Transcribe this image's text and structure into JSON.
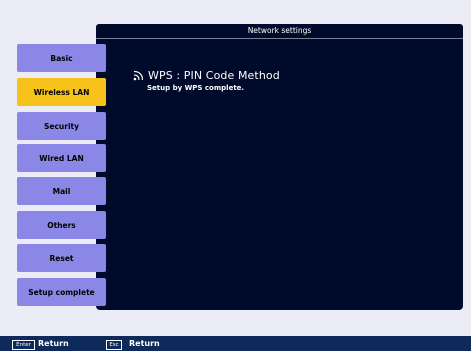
{
  "window": {
    "title": "Network settings"
  },
  "sidebar": {
    "items": [
      {
        "label": "Basic",
        "state": "normal"
      },
      {
        "label": "Wireless LAN",
        "state": "selected"
      },
      {
        "label": "Security",
        "state": "normal"
      },
      {
        "label": "Wired LAN",
        "state": "normal"
      },
      {
        "label": "Mail",
        "state": "normal"
      },
      {
        "label": "Others",
        "state": "normal"
      },
      {
        "label": "Reset",
        "state": "normal"
      },
      {
        "label": "Setup complete",
        "state": "normal"
      }
    ]
  },
  "content": {
    "icon": "wifi-icon",
    "title": "WPS : PIN Code Method",
    "message": "Setup by WPS complete."
  },
  "footer": {
    "keys": [
      {
        "key": "Enter",
        "label": "Return"
      },
      {
        "key": "Esc",
        "label": "Return"
      }
    ]
  },
  "colors": {
    "panel": "#000a2a",
    "tab": "#8b87e6",
    "tab_selected": "#f7c21a",
    "footer": "#0e2a5a"
  }
}
